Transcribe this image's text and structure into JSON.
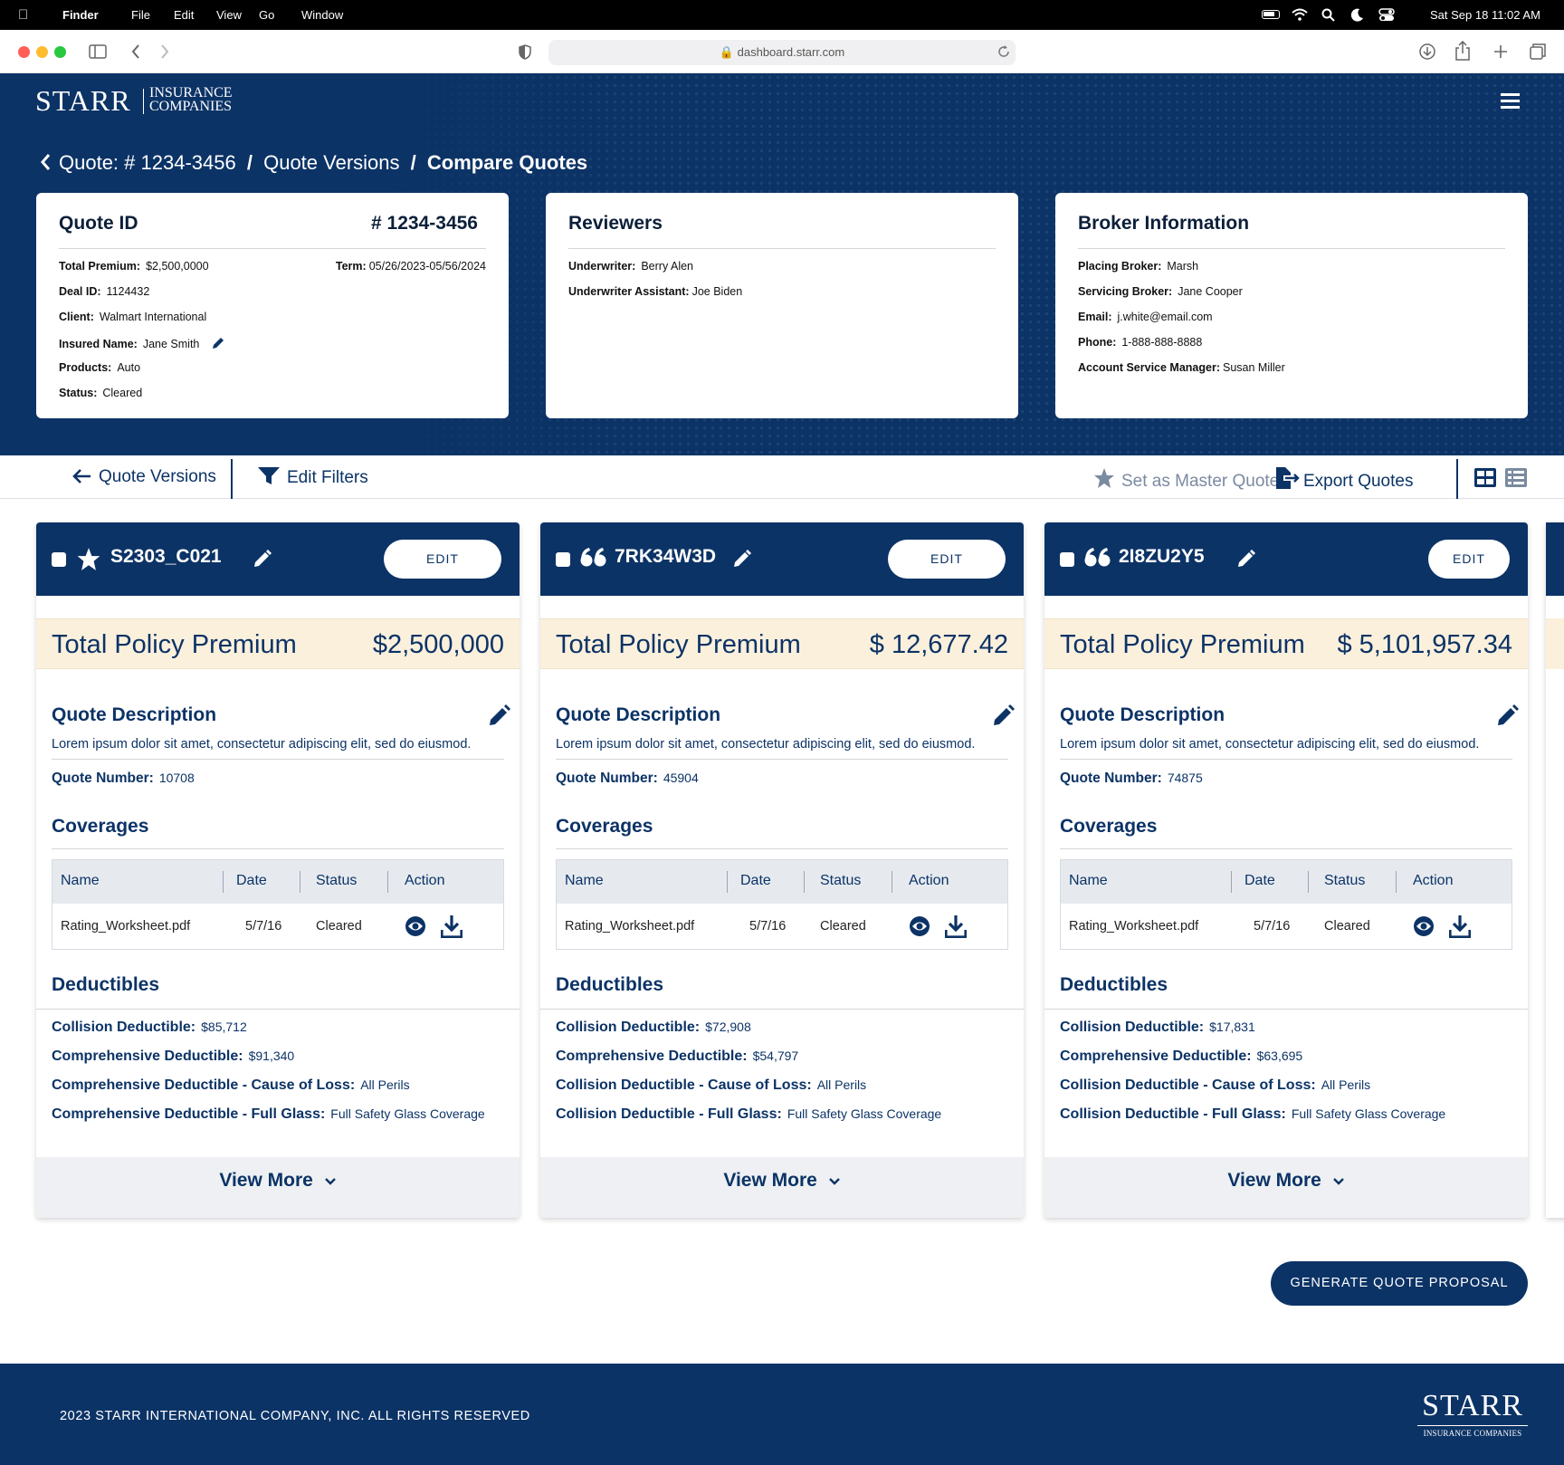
{
  "menubar": {
    "app": "Finder",
    "items": [
      "File",
      "Edit",
      "View",
      "Go",
      "Window"
    ],
    "datetime": "Sat Sep 18  11:02 AM"
  },
  "browser": {
    "url": "dashboard.starr.com"
  },
  "brand": {
    "name": "STARR",
    "sub_line1": "INSURANCE",
    "sub_line2": "COMPANIES"
  },
  "breadcrumb": {
    "crumb1": "Quote: # 1234-3456",
    "sep": "/",
    "crumb2": "Quote Versions",
    "crumb3": "Compare Quotes"
  },
  "quote_card": {
    "title": "Quote ID",
    "id": "# 1234-3456",
    "rows": [
      {
        "label": "Total Premium:",
        "value": "$2,500,0000"
      },
      {
        "label": "Deal ID:",
        "value": "1124432"
      },
      {
        "label": "Client:",
        "value": "Walmart International"
      },
      {
        "label": "Insured Name:",
        "value": "Jane Smith"
      },
      {
        "label": "Products:",
        "value": "Auto"
      },
      {
        "label": "Status:",
        "value": "Cleared"
      }
    ],
    "term_label": "Term:",
    "term_value": "05/26/2023-05/56/2024"
  },
  "reviewers_card": {
    "title": "Reviewers",
    "rows": [
      {
        "label": "Underwriter:",
        "value": "Berry Alen"
      },
      {
        "label": "Underwriter Assistant:",
        "value": "Joe Biden"
      }
    ]
  },
  "broker_card": {
    "title": "Broker Information",
    "rows": [
      {
        "label": "Placing Broker:",
        "value": "Marsh"
      },
      {
        "label": "Servicing Broker:",
        "value": "Jane Cooper"
      },
      {
        "label": "Email:",
        "value": "j.white@email.com"
      },
      {
        "label": "Phone:",
        "value": "1-888-888-8888"
      },
      {
        "label": "Account Service Manager:",
        "value": "Susan Miller"
      }
    ]
  },
  "toolbar": {
    "quote_versions": "Quote Versions",
    "edit_filters": "Edit Filters",
    "set_master": "Set as Master Quote",
    "export": "Export Quotes"
  },
  "quotes": [
    {
      "id": "S2303_C021",
      "icon": "star-icon",
      "edit_label": "EDIT",
      "premium_label": "Total Policy Premium",
      "premium": "$2,500,000",
      "desc_title": "Quote Description",
      "description": "Lorem ipsum dolor sit amet, consectetur adipiscing elit, sed do eiusmod.",
      "quote_number_label": "Quote Number:",
      "quote_number": "10708",
      "coverages_title": "Coverages",
      "cov_headers": [
        "Name",
        "Date",
        "Status",
        "Action"
      ],
      "cov_row": {
        "name": "Rating_Worksheet.pdf",
        "date": "5/7/16",
        "status": "Cleared"
      },
      "deductibles_title": "Deductibles",
      "deductibles": [
        {
          "label": "Collision Deductible:",
          "value": "$85,712"
        },
        {
          "label": "Comprehensive Deductible:",
          "value": "$91,340"
        },
        {
          "label": "Comprehensive Deductible - Cause of Loss:",
          "value": "All Perils"
        },
        {
          "label": "Comprehensive Deductible - Full Glass:",
          "value": "Full Safety Glass Coverage"
        }
      ],
      "view_more": "View More"
    },
    {
      "id": "7RK34W3D",
      "icon": "quote-icon",
      "edit_label": "EDIT",
      "premium_label": "Total Policy Premium",
      "premium": "$ 12,677.42",
      "desc_title": "Quote Description",
      "description": "Lorem ipsum dolor sit amet, consectetur adipiscing elit, sed do eiusmod.",
      "quote_number_label": "Quote Number:",
      "quote_number": "45904",
      "coverages_title": "Coverages",
      "cov_headers": [
        "Name",
        "Date",
        "Status",
        "Action"
      ],
      "cov_row": {
        "name": "Rating_Worksheet.pdf",
        "date": "5/7/16",
        "status": "Cleared"
      },
      "deductibles_title": "Deductibles",
      "deductibles": [
        {
          "label": "Collision Deductible:",
          "value": "$72,908"
        },
        {
          "label": "Comprehensive Deductible:",
          "value": "$54,797"
        },
        {
          "label": "Collision Deductible - Cause of Loss:",
          "value": "All Perils"
        },
        {
          "label": "Collision Deductible - Full Glass:",
          "value": "Full Safety Glass Coverage"
        }
      ],
      "view_more": "View More"
    },
    {
      "id": "2I8ZU2Y5",
      "icon": "quote-icon",
      "edit_label": "EDIT",
      "premium_label": "Total Policy Premium",
      "premium": "$ 5,101,957.34",
      "desc_title": "Quote Description",
      "description": "Lorem ipsum dolor sit amet, consectetur adipiscing elit, sed do eiusmod.",
      "quote_number_label": "Quote Number:",
      "quote_number": "74875",
      "coverages_title": "Coverages",
      "cov_headers": [
        "Name",
        "Date",
        "Status",
        "Action"
      ],
      "cov_row": {
        "name": "Rating_Worksheet.pdf",
        "date": "5/7/16",
        "status": "Cleared"
      },
      "deductibles_title": "Deductibles",
      "deductibles": [
        {
          "label": "Collision Deductible:",
          "value": "$17,831"
        },
        {
          "label": "Comprehensive Deductible:",
          "value": "$63,695"
        },
        {
          "label": "Collision Deductible - Cause of Loss:",
          "value": "All Perils"
        },
        {
          "label": "Collision Deductible - Full Glass:",
          "value": "Full Safety Glass Coverage"
        }
      ],
      "view_more": "View More"
    }
  ],
  "generate_button": "GENERATE QUOTE PROPOSAL",
  "footer": {
    "copyright": "2023 STARR INTERNATIONAL COMPANY, INC. ALL RIGHTS RESERVED",
    "logo_name": "STARR",
    "logo_sub": "INSURANCE COMPANIES"
  },
  "colors": {
    "navy": "#0c3366",
    "premium_bg": "#fbf0dc",
    "table_head": "#e6eaef"
  }
}
